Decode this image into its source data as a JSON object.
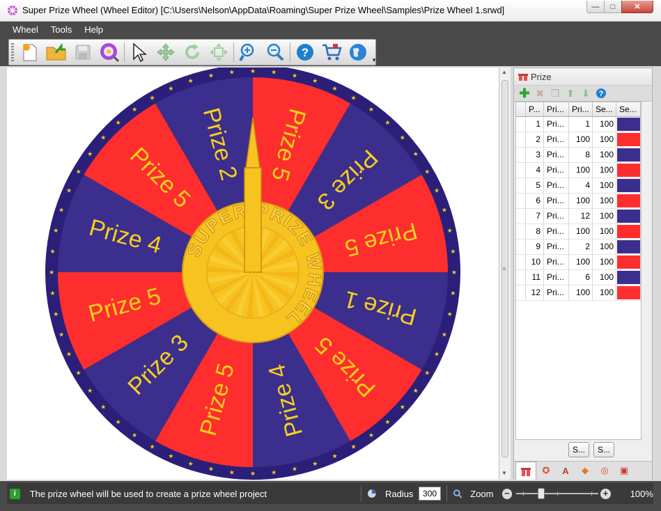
{
  "window": {
    "title": "Super Prize Wheel (Wheel Editor) [C:\\Users\\Nelson\\AppData\\Roaming\\Super Prize Wheel\\Samples\\Prize Wheel 1.srwd]",
    "min_glyph": "—",
    "max_glyph": "□",
    "close_glyph": "✕"
  },
  "menu": {
    "items": [
      "Wheel",
      "Tools",
      "Help"
    ]
  },
  "toolbar": {
    "buttons": [
      "new-wheel",
      "open-wheel",
      "save-wheel",
      "wheel-preview",
      "select-pointer",
      "move",
      "rotate",
      "resize",
      "zoom-in",
      "zoom-out",
      "help",
      "buy",
      "website"
    ]
  },
  "colors": {
    "red": "#ff2e2e",
    "blue": "#3c2e8c",
    "ring": "#2b1f7a",
    "gold": "#f7c321",
    "text_gold": "#f5cf1e"
  },
  "wheel": {
    "segments": [
      {
        "label": "Prize 5",
        "color": "red"
      },
      {
        "label": "Prize 3",
        "color": "blue"
      },
      {
        "label": "Prize 5",
        "color": "red"
      },
      {
        "label": "Prize 1",
        "color": "blue"
      },
      {
        "label": "Prize 5",
        "color": "red"
      },
      {
        "label": "Prize 4",
        "color": "blue"
      },
      {
        "label": "Prize 5",
        "color": "red"
      },
      {
        "label": "Prize 3",
        "color": "blue"
      },
      {
        "label": "Prize 5",
        "color": "red"
      },
      {
        "label": "Prize 4",
        "color": "blue"
      },
      {
        "label": "Prize 5",
        "color": "red"
      },
      {
        "label": "Prize 2",
        "color": "blue"
      }
    ],
    "center_text": "SUPER PRIZE WHEEL"
  },
  "panel": {
    "title": "Prize",
    "tools": [
      "add",
      "delete",
      "copy",
      "move-up",
      "move-down",
      "help"
    ],
    "columns": [
      "P...",
      "Pri...",
      "Pri...",
      "Se...",
      "Se..."
    ],
    "rows": [
      {
        "no": "1",
        "name": "Pri...",
        "prob": "1",
        "sec": "100",
        "color": "blue"
      },
      {
        "no": "2",
        "name": "Pri...",
        "prob": "100",
        "sec": "100",
        "color": "red"
      },
      {
        "no": "3",
        "name": "Pri...",
        "prob": "8",
        "sec": "100",
        "color": "blue"
      },
      {
        "no": "4",
        "name": "Pri...",
        "prob": "100",
        "sec": "100",
        "color": "red"
      },
      {
        "no": "5",
        "name": "Pri...",
        "prob": "4",
        "sec": "100",
        "color": "blue"
      },
      {
        "no": "6",
        "name": "Pri...",
        "prob": "100",
        "sec": "100",
        "color": "red"
      },
      {
        "no": "7",
        "name": "Pri...",
        "prob": "12",
        "sec": "100",
        "color": "blue"
      },
      {
        "no": "8",
        "name": "Pri...",
        "prob": "100",
        "sec": "100",
        "color": "red"
      },
      {
        "no": "9",
        "name": "Pri...",
        "prob": "2",
        "sec": "100",
        "color": "blue"
      },
      {
        "no": "10",
        "name": "Pri...",
        "prob": "100",
        "sec": "100",
        "color": "red"
      },
      {
        "no": "11",
        "name": "Pri...",
        "prob": "6",
        "sec": "100",
        "color": "blue"
      },
      {
        "no": "12",
        "name": "Pri...",
        "prob": "100",
        "sec": "100",
        "color": "red"
      }
    ],
    "buttons": [
      "S...",
      "S..."
    ],
    "tabs": [
      "prize-tab",
      "pointer-tab",
      "text-tab",
      "marker-tab",
      "ring-tab",
      "background-tab"
    ]
  },
  "status": {
    "message": "The prize wheel will be used to create a prize wheel project",
    "radius_label": "Radius",
    "radius_value": "300",
    "zoom_label": "Zoom",
    "zoom_value": "100%",
    "zoom_level_fraction": 0.28
  }
}
